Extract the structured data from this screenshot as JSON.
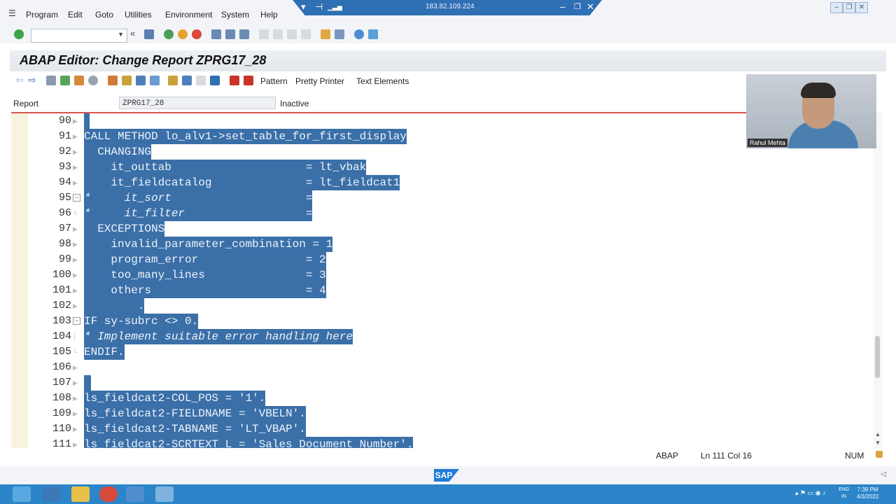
{
  "menu": {
    "items": [
      "Program",
      "Edit",
      "Goto",
      "Utilities",
      "Environment",
      "System",
      "Help"
    ]
  },
  "remote": {
    "ip": "183.82.109.224"
  },
  "title": "ABAP Editor: Change Report ZPRG17_28",
  "app_toolbar": {
    "pattern_label": "Pattern",
    "pretty_printer_label": "Pretty Printer",
    "text_elements_label": "Text Elements"
  },
  "report": {
    "label": "Report",
    "value": "ZPRG17_28",
    "status": "Inactive"
  },
  "editor": {
    "lines": [
      {
        "num": "90",
        "text": ""
      },
      {
        "num": "91",
        "text": "CALL METHOD lo_alv1->set_table_for_first_display"
      },
      {
        "num": "92",
        "text": "  CHANGING"
      },
      {
        "num": "93",
        "text": "    it_outtab                    = lt_vbak"
      },
      {
        "num": "94",
        "text": "    it_fieldcatalog              = lt_fieldcat1"
      },
      {
        "num": "95",
        "text": "*     it_sort                    ="
      },
      {
        "num": "96",
        "text": "*     it_filter                  ="
      },
      {
        "num": "97",
        "text": "  EXCEPTIONS"
      },
      {
        "num": "98",
        "text": "    invalid_parameter_combination = 1"
      },
      {
        "num": "99",
        "text": "    program_error                = 2"
      },
      {
        "num": "100",
        "text": "    too_many_lines               = 3"
      },
      {
        "num": "101",
        "text": "    others                       = 4"
      },
      {
        "num": "102",
        "text": "        ."
      },
      {
        "num": "103",
        "text": "IF sy-subrc <> 0."
      },
      {
        "num": "104",
        "text": "* Implement suitable error handling here"
      },
      {
        "num": "105",
        "text": "ENDIF."
      },
      {
        "num": "106",
        "text": ""
      },
      {
        "num": "107",
        "text": ""
      },
      {
        "num": "108",
        "text": "ls_fieldcat2-COL_POS = '1'."
      },
      {
        "num": "109",
        "text": "ls_fieldcat2-FIELDNAME = 'VBELN'."
      },
      {
        "num": "110",
        "text": "ls_fieldcat2-TABNAME = 'LT_VBAP'."
      },
      {
        "num": "111",
        "text": "ls_fieldcat2-SCRTEXT_L = 'Sales Document Number'."
      }
    ]
  },
  "webcam": {
    "name": "Rahul Mehta"
  },
  "status": {
    "language": "ABAP",
    "position": "Ln 111 Col 16",
    "num": "NUM"
  },
  "sap_logo": "SAP",
  "taskbar": {
    "lang_top": "ENG",
    "lang_bottom": "IN",
    "time": "7:39 PM",
    "date": "4/3/2022"
  }
}
